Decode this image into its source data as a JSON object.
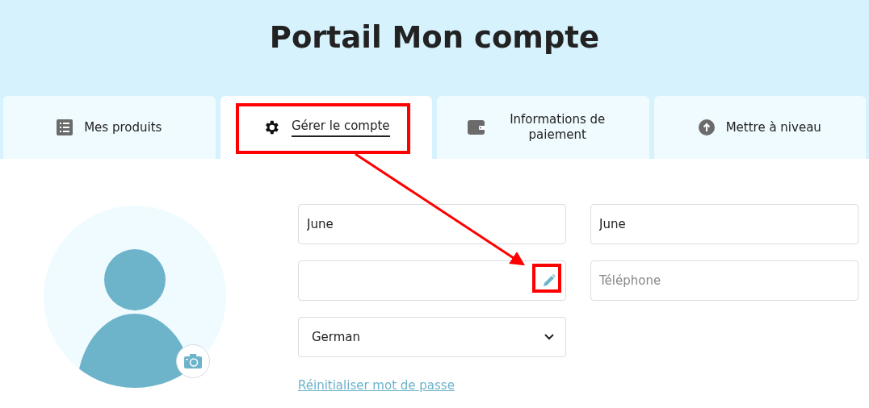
{
  "title": "Portail Mon compte",
  "tabs": [
    {
      "label": "Mes produits",
      "kind": "list",
      "selected": false
    },
    {
      "label": "Gérer le compte",
      "kind": "gear",
      "selected": true
    },
    {
      "label": "Informations de paiement",
      "kind": "wallet",
      "selected": false
    },
    {
      "label": "Mettre à niveau",
      "kind": "upgrade",
      "selected": false
    }
  ],
  "fields": [
    {
      "kind": "text",
      "value": "June"
    },
    {
      "kind": "text",
      "value": "June"
    },
    {
      "kind": "edit"
    },
    {
      "kind": "text",
      "placeholder": "Téléphone"
    },
    {
      "kind": "select",
      "value": "German"
    }
  ],
  "reset_link": "Réinitialiser mot de passe"
}
